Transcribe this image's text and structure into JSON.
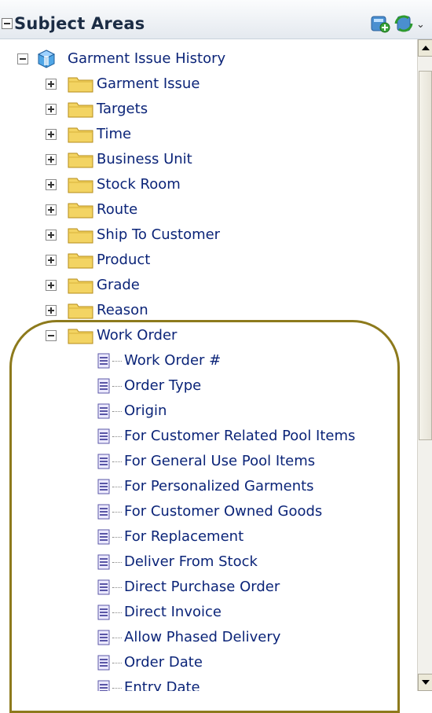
{
  "panel": {
    "title": "Subject Areas"
  },
  "header_icons": [
    "add-subject-area-icon",
    "refresh-icon",
    "chevron-down-icon"
  ],
  "tree": {
    "root": {
      "label": "Garment Issue History",
      "icon": "cube-icon",
      "expanded": true
    },
    "folders": [
      {
        "label": "Garment Issue",
        "expanded": false
      },
      {
        "label": "Targets",
        "expanded": false
      },
      {
        "label": "Time",
        "expanded": false
      },
      {
        "label": "Business Unit",
        "expanded": false
      },
      {
        "label": "Stock Room",
        "expanded": false
      },
      {
        "label": "Route",
        "expanded": false
      },
      {
        "label": "Ship To Customer",
        "expanded": false
      },
      {
        "label": "Product",
        "expanded": false
      },
      {
        "label": "Grade",
        "expanded": false
      },
      {
        "label": "Reason",
        "expanded": false
      },
      {
        "label": "Work Order",
        "expanded": true
      }
    ],
    "work_order_columns": [
      "Work Order #",
      "Order Type",
      "Origin",
      "For Customer Related Pool Items",
      "For General Use Pool Items",
      "For Personalized Garments",
      "For Customer Owned Goods",
      "For Replacement",
      "Deliver From Stock",
      "Direct Purchase Order",
      "Direct Invoice",
      "Allow Phased Delivery",
      "Order Date",
      "Entry Date"
    ]
  },
  "colors": {
    "label": "#0b2478",
    "highlight_border": "#8d7a1c",
    "folder": "#f1d060"
  }
}
